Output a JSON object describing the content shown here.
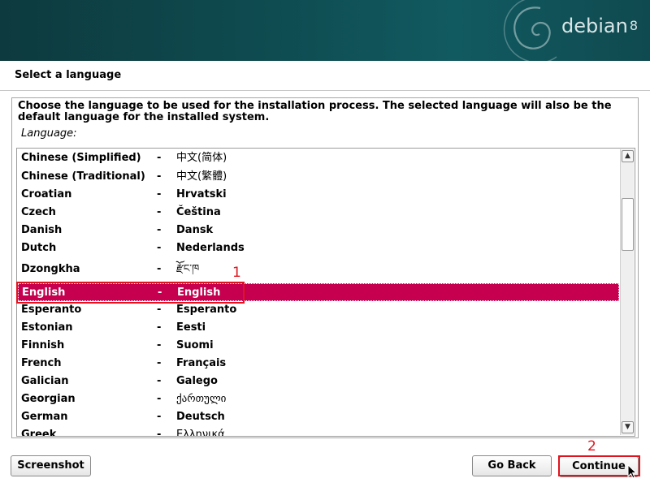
{
  "banner": {
    "brand": "debian",
    "version": "8"
  },
  "page": {
    "heading": "Select a language",
    "intro": "Choose the language to be used for the installation process. The selected language will also be the default language for the installed system.",
    "field_label": "Language:"
  },
  "languages": [
    {
      "name": "Chinese (Simplified)",
      "dash": "-",
      "native": "中文(简体)"
    },
    {
      "name": "Chinese (Traditional)",
      "dash": "-",
      "native": "中文(繁體)"
    },
    {
      "name": "Croatian",
      "dash": "-",
      "native": "Hrvatski"
    },
    {
      "name": "Czech",
      "dash": "-",
      "native": "Čeština"
    },
    {
      "name": "Danish",
      "dash": "-",
      "native": "Dansk"
    },
    {
      "name": "Dutch",
      "dash": "-",
      "native": "Nederlands"
    },
    {
      "name": "Dzongkha",
      "dash": "-",
      "native": "རྫོང་ཁ"
    },
    {
      "name": "English",
      "dash": "-",
      "native": "English"
    },
    {
      "name": "Esperanto",
      "dash": "-",
      "native": "Esperanto"
    },
    {
      "name": "Estonian",
      "dash": "-",
      "native": "Eesti"
    },
    {
      "name": "Finnish",
      "dash": "-",
      "native": "Suomi"
    },
    {
      "name": "French",
      "dash": "-",
      "native": "Français"
    },
    {
      "name": "Galician",
      "dash": "-",
      "native": "Galego"
    },
    {
      "name": "Georgian",
      "dash": "-",
      "native": "ქართული"
    },
    {
      "name": "German",
      "dash": "-",
      "native": "Deutsch"
    },
    {
      "name": "Greek",
      "dash": "-",
      "native": "Ελληνικά"
    }
  ],
  "selected_language": "English",
  "annotations": {
    "first": "1",
    "second": "2"
  },
  "buttons": {
    "screenshot": "Screenshot",
    "go_back": "Go Back",
    "continue": "Continue"
  },
  "colors": {
    "banner": "#0e4b50",
    "selection": "#c6004f",
    "annotation": "#e0141e"
  },
  "icons": {
    "scroll_up": "scroll-up-arrow-icon",
    "scroll_down": "scroll-down-arrow-icon",
    "cursor": "mouse-pointer-icon",
    "swirl": "debian-swirl-logo"
  }
}
